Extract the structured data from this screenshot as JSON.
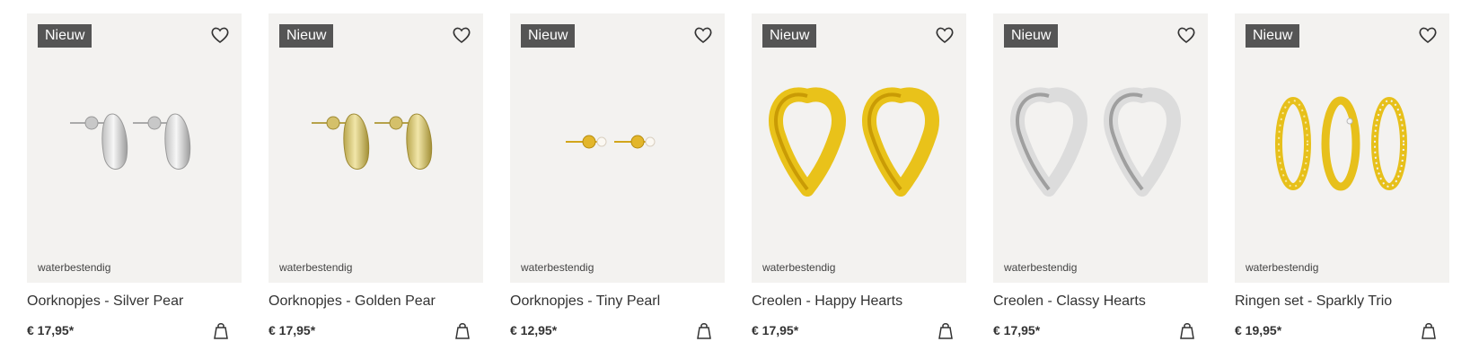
{
  "products": [
    {
      "badge": "Nieuw",
      "tag": "waterbestendig",
      "title": "Oorknopjes - Silver Pear",
      "price": "€ 17,95*",
      "visual": "silver-pear-earrings"
    },
    {
      "badge": "Nieuw",
      "tag": "waterbestendig",
      "title": "Oorknopjes - Golden Pear",
      "price": "€ 17,95*",
      "visual": "golden-pear-earrings"
    },
    {
      "badge": "Nieuw",
      "tag": "waterbestendig",
      "title": "Oorknopjes - Tiny Pearl",
      "price": "€ 12,95*",
      "visual": "tiny-pearl-earrings"
    },
    {
      "badge": "Nieuw",
      "tag": "waterbestendig",
      "title": "Creolen - Happy Hearts",
      "price": "€ 17,95*",
      "visual": "gold-heart-hoops"
    },
    {
      "badge": "Nieuw",
      "tag": "waterbestendig",
      "title": "Creolen - Classy Hearts",
      "price": "€ 17,95*",
      "visual": "silver-heart-hoops"
    },
    {
      "badge": "Nieuw",
      "tag": "waterbestendig",
      "title": "Ringen set - Sparkly Trio",
      "price": "€ 19,95*",
      "visual": "gold-ring-set"
    }
  ],
  "icons": {
    "wishlist": "heart-outline-icon",
    "cart": "shopping-bag-icon"
  },
  "colors": {
    "badge_bg": "#555555",
    "card_bg": "#f3f2f0",
    "text": "#333333",
    "gold": "#e8c21f",
    "silver": "#d9d9d9"
  }
}
